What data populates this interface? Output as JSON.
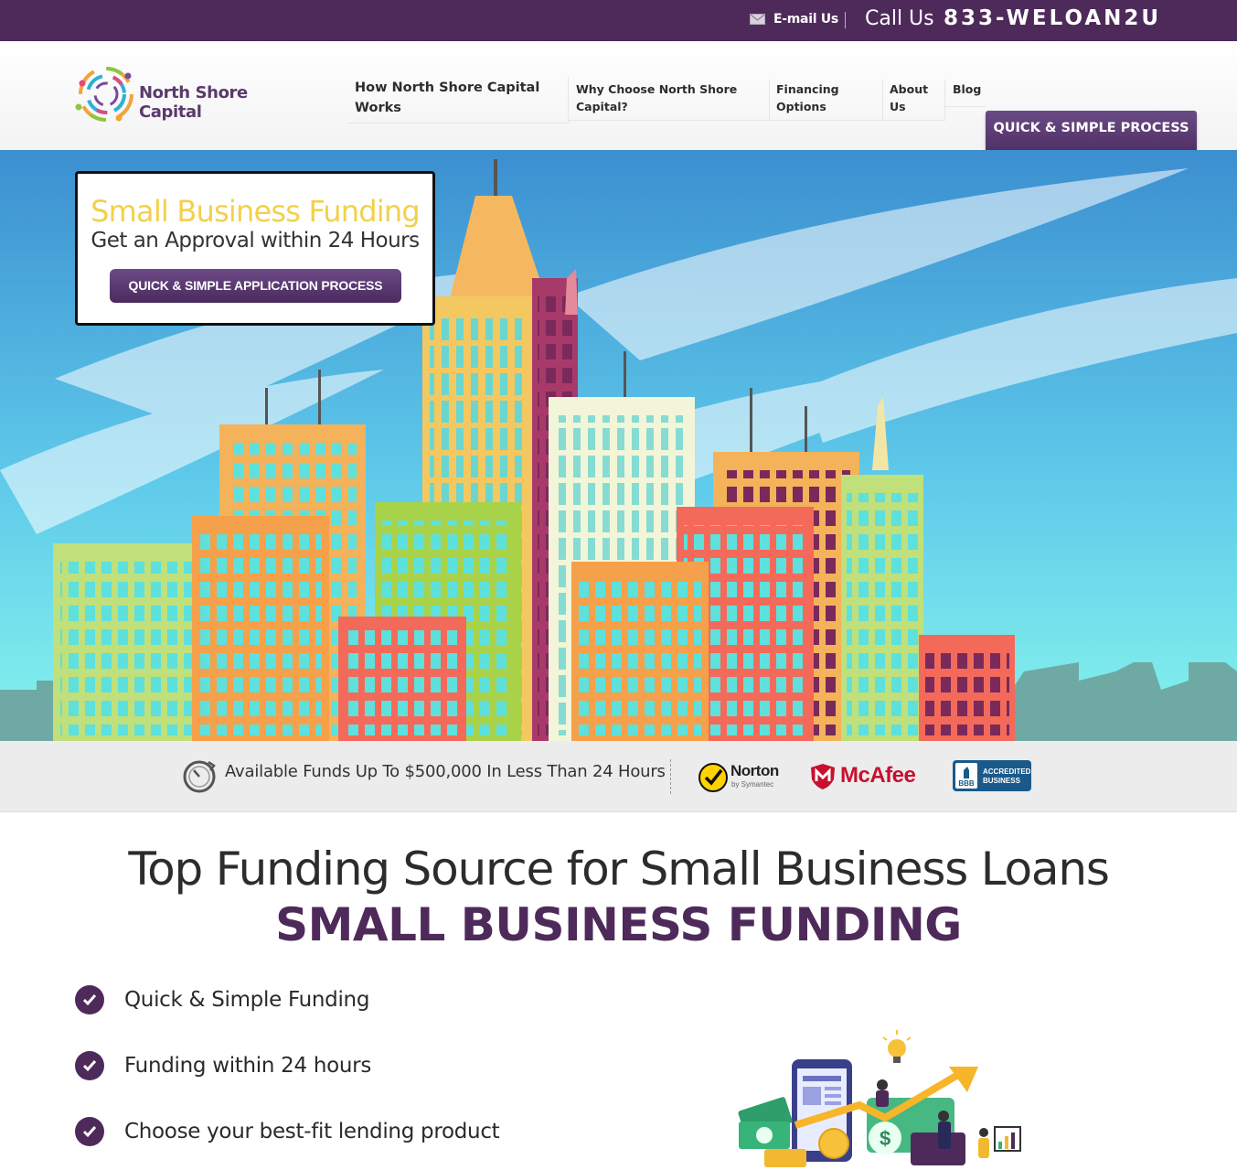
{
  "topbar": {
    "email_label": "E-mail Us",
    "call_label": "Call Us",
    "phone": "833-WELOAN2U"
  },
  "header": {
    "logo_text": "North Shore Capital",
    "nav": [
      {
        "label": "How North Shore Capital Works"
      },
      {
        "label": "Why Choose North Shore Capital?"
      },
      {
        "label": "Financing Options"
      },
      {
        "label": "About Us"
      },
      {
        "label": "Blog"
      }
    ],
    "cta_label": "QUICK & SIMPLE PROCESS"
  },
  "hero": {
    "title": "Small Business Funding",
    "subtitle": "Get an Approval within 24 Hours",
    "button_label": "QUICK & SIMPLE APPLICATION PROCESS"
  },
  "trust": {
    "funds_text": "Available Funds Up To $500,000 In Less Than 24 Hours",
    "norton": "Norton",
    "norton_sub": "by Symantec",
    "mcafee": "McAfee",
    "bbb": "BBB",
    "bbb_line1": "ACCREDITED",
    "bbb_line2": "BUSINESS"
  },
  "main": {
    "title": "Top Funding Source for Small Business Loans",
    "subtitle": "SMALL BUSINESS FUNDING",
    "features": [
      {
        "text": "Quick & Simple Funding"
      },
      {
        "text": "Funding within 24 hours"
      },
      {
        "text": "Choose your best-fit lending product"
      }
    ]
  },
  "colors": {
    "brand_purple": "#4e2a5a",
    "hero_title_yellow": "#f2d14a",
    "sky_top": "#3c8fd0",
    "sky_bottom": "#86f5ec"
  }
}
